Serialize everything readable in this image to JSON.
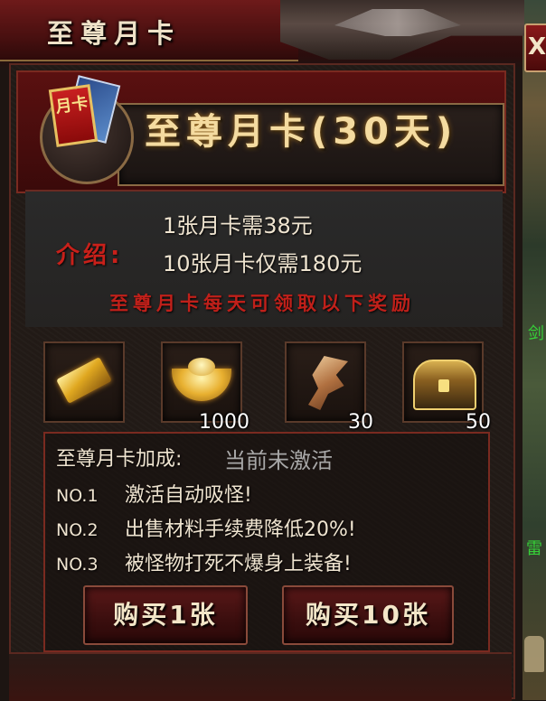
{
  "window": {
    "title": "至尊月卡",
    "close_label": "X"
  },
  "banner": {
    "title": "至尊月卡(30天)",
    "card_glyph": "月卡"
  },
  "intro": {
    "label": "介绍:",
    "line1": "1张月卡需38元",
    "line2": "10张月卡仅需180元"
  },
  "rewards": {
    "header": "至尊月卡每天可领取以下奖励",
    "items": [
      {
        "icon": "gold-bar-icon",
        "count": ""
      },
      {
        "icon": "gold-ingot-icon",
        "count": "1000"
      },
      {
        "icon": "wing-feather-icon",
        "count": "30"
      },
      {
        "icon": "treasure-chest-icon",
        "count": "50"
      }
    ]
  },
  "bonus": {
    "title": "至尊月卡加成:",
    "status": "当前未激活",
    "items": [
      {
        "no": "NO.1",
        "text": "激活自动吸怪!"
      },
      {
        "no": "NO.2",
        "text": "出售材料手续费降低20%!"
      },
      {
        "no": "NO.3",
        "text": "被怪物打死不爆身上装备!"
      }
    ]
  },
  "buttons": {
    "buy_one": "购买1张",
    "buy_ten": "购买10张"
  },
  "background": {
    "side_text_1": "剑",
    "side_text_2": "雷"
  }
}
